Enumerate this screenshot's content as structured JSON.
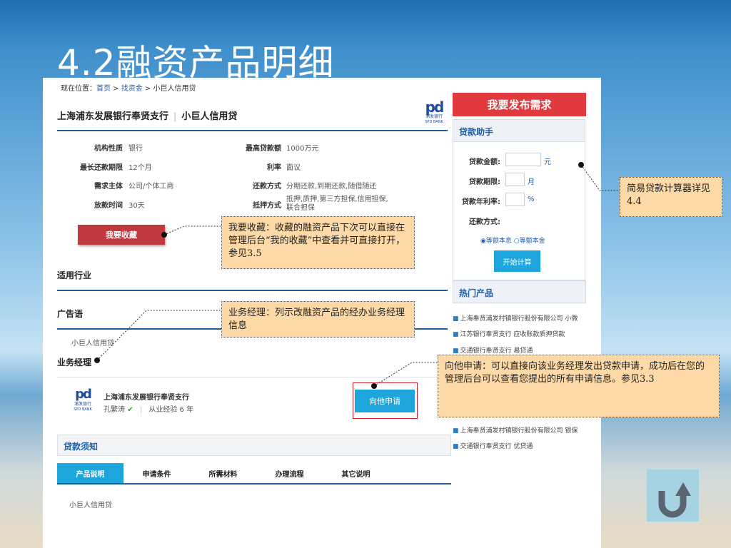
{
  "slide": {
    "title": "4.2融资产品明细"
  },
  "breadcrumb": {
    "prefix": "现在位置：",
    "home": "首页",
    "sep1": " > ",
    "section": "找资金",
    "sep2": " > ",
    "current": "小巨人信用贷"
  },
  "product": {
    "bank": "上海浦东发展银行奉贤支行",
    "sep": "|",
    "name": "小巨人信用贷",
    "logo_mark": "pd",
    "logo_cn": "浦发银行",
    "logo_en": "SPD BANK"
  },
  "info": [
    {
      "label": "机构性质",
      "value": "银行"
    },
    {
      "label": "最高贷款额",
      "value": "1000万元"
    },
    {
      "label": "最长还款期限",
      "value": "12个月"
    },
    {
      "label": "利率",
      "value": "面议"
    },
    {
      "label": "需求主体",
      "value": "公司/个体工商"
    },
    {
      "label": "还款方式",
      "value": "分期还款,到期还款,随借随还"
    },
    {
      "label": "放款时间",
      "value": "30天"
    },
    {
      "label": "抵押方式",
      "value": "抵押,质押,第三方担保,信用担保,联合担保"
    }
  ],
  "favorite_label": "我要收藏",
  "sections": {
    "industry": "适用行业",
    "slogan": "广告语",
    "slogan_text": "小巨人信用贷",
    "manager": "业务经理"
  },
  "manager": {
    "bank": "上海浦东发展银行奉贤支行",
    "name": "孔繁涛",
    "sep": "|",
    "experience": "从业经验 6 年",
    "apply_label": "向他申请"
  },
  "notice": {
    "title": "贷款须知",
    "tabs": [
      "产品说明",
      "申请条件",
      "所需材料",
      "办理流程",
      "其它说明"
    ],
    "content": "小巨人信用贷"
  },
  "sidebar": {
    "publish_label": "我要发布需求",
    "helper_title": "贷款助手",
    "calc": {
      "amount_label": "贷款金额:",
      "amount_unit": "元",
      "term_label": "贷款期限:",
      "term_unit": "月",
      "rate_label": "贷款年利率:",
      "rate_unit": "%",
      "method_label": "还款方式:",
      "option1": "等额本息",
      "option2": "等额本金",
      "button": "开始计算"
    },
    "hot_title": "热门产品",
    "hot_items": [
      "上海奉贤浦发村镇银行股份有限公司  小微",
      "江苏银行奉贤支行  应收账款质押贷款",
      "交通银行奉贤支行  易贷通",
      "上海奉贤浦发村镇银行股份有限公司  银保",
      "交通银行奉贤支行  优贷通"
    ]
  },
  "callouts": {
    "favorite": "我要收藏：收藏的融资产品下次可以直接在管理后台“我的收藏”中查看并可直接打开，参见3.5",
    "manager": "业务经理：列示改融资产品的经办业务经理信息",
    "apply": "向他申请：可以直接向该业务经理发出贷款申请，成功后在您的管理后台可以查看您提出的所有申请信息。参见3.3",
    "calculator": "简易贷款计算器详见4.4"
  },
  "colors": {
    "accent_blue": "#1ea6dc",
    "link_blue": "#1f5fa8",
    "publish_red": "#e03a3e",
    "favorite_red": "#c0393e",
    "callout_bg": "#fcd9a6"
  },
  "icons": {
    "home": "u-turn-return-icon",
    "verified": "verified-badge-icon"
  }
}
